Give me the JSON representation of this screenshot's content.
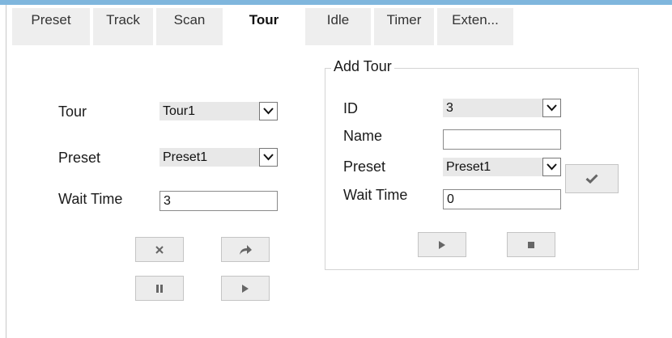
{
  "tabs": [
    {
      "label": "Preset",
      "active": false
    },
    {
      "label": "Track",
      "active": false
    },
    {
      "label": "Scan",
      "active": false
    },
    {
      "label": "Tour",
      "active": true
    },
    {
      "label": "Idle",
      "active": false
    },
    {
      "label": "Timer",
      "active": false
    },
    {
      "label": "Exten...",
      "active": false
    }
  ],
  "tour_panel": {
    "tour_label": "Tour",
    "tour_value": "Tour1",
    "preset_label": "Preset",
    "preset_value": "Preset1",
    "wait_time_label": "Wait Time",
    "wait_time_value": "3",
    "buttons": {
      "delete_icon": "close-icon",
      "next_icon": "arrow-right-icon",
      "pause_icon": "pause-icon",
      "play_icon": "play-icon"
    }
  },
  "add_tour": {
    "legend": "Add Tour",
    "id_label": "ID",
    "id_value": "3",
    "name_label": "Name",
    "name_value": "",
    "preset_label": "Preset",
    "preset_value": "Preset1",
    "wait_time_label": "Wait Time",
    "wait_time_value": "0",
    "buttons": {
      "confirm_icon": "check-icon",
      "play_icon": "play-icon",
      "stop_icon": "stop-icon"
    }
  },
  "colors": {
    "topbar": "#7fb6dd",
    "tab_bg": "#eeeeee",
    "button_bg": "#ececec",
    "icon": "#666666"
  }
}
